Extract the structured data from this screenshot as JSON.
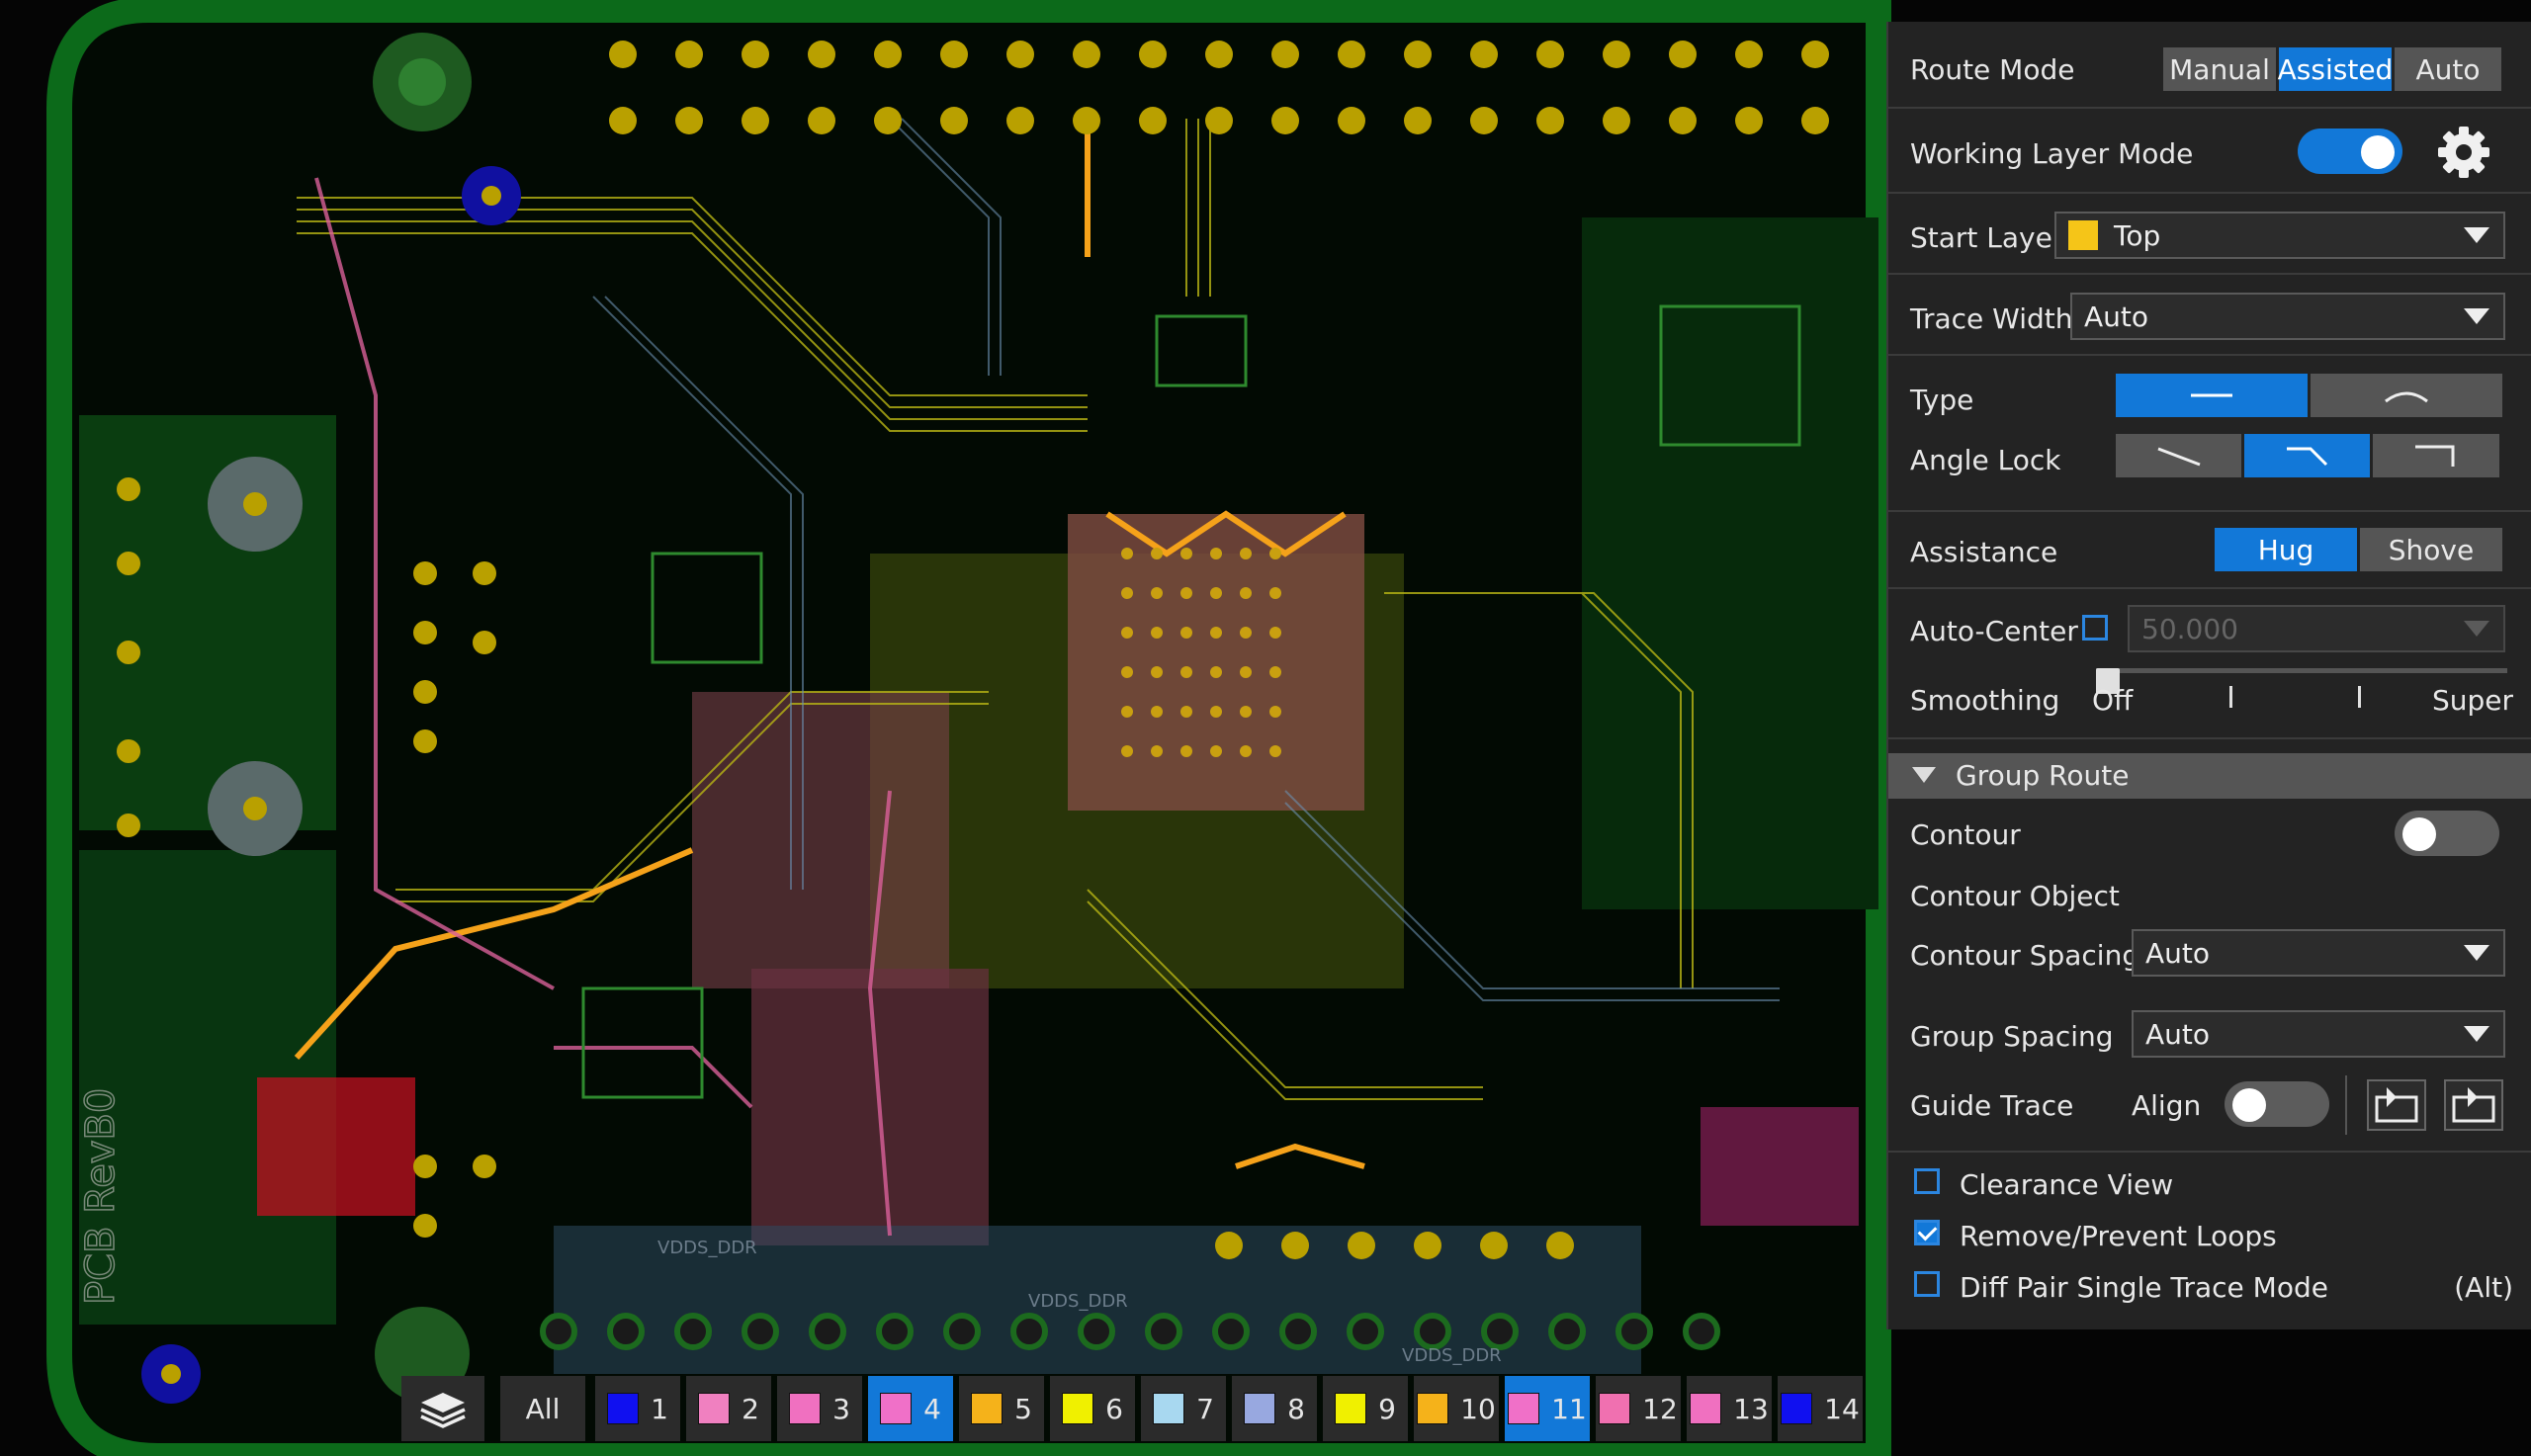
{
  "colors": {
    "accent": "#1278d8",
    "panel_bg": "#232323",
    "board_green": "#0b4d14",
    "trace_yellow": "#b9b615",
    "trace_orange": "#f5a21a",
    "trace_pink": "#d9609a",
    "trace_blue": "#3a55d0"
  },
  "panel": {
    "route_mode": {
      "label": "Route Mode",
      "options": [
        "Manual",
        "Assisted",
        "Auto"
      ],
      "selected": "Assisted"
    },
    "working_layer_mode": {
      "label": "Working Layer Mode",
      "on": true,
      "icon": "gear-icon"
    },
    "start_layer": {
      "label": "Start Layer",
      "value": "Top",
      "swatch": "#f5c518"
    },
    "trace_width": {
      "label": "Trace Width",
      "value": "Auto"
    },
    "type": {
      "label": "Type",
      "options": [
        "straight-line-icon",
        "arc-icon"
      ],
      "selected": "straight-line-icon"
    },
    "angle_lock": {
      "label": "Angle Lock",
      "options": [
        "any-angle-icon",
        "angle-45-icon",
        "angle-90-icon"
      ],
      "selected": "angle-45-icon"
    },
    "assistance": {
      "label": "Assistance",
      "options": [
        "Hug",
        "Shove"
      ],
      "selected": "Hug"
    },
    "auto_center": {
      "label": "Auto-Center",
      "checked": false,
      "value": "50.000"
    },
    "smoothing": {
      "label": "Smoothing",
      "min_label": "Off",
      "max_label": "Super",
      "level": 0
    },
    "group_route": {
      "header": "Group Route",
      "contour": {
        "label": "Contour",
        "on": false
      },
      "contour_object": {
        "label": "Contour Object"
      },
      "contour_spacing": {
        "label": "Contour Spacing",
        "value": "Auto"
      },
      "group_spacing": {
        "label": "Group Spacing",
        "value": "Auto"
      },
      "guide_trace": {
        "label": "Guide Trace",
        "align_label": "Align",
        "align_on": false
      }
    },
    "checkboxes": [
      {
        "label": "Clearance View",
        "checked": false,
        "hint": ""
      },
      {
        "label": "Remove/Prevent Loops",
        "checked": true,
        "hint": ""
      },
      {
        "label": "Diff Pair Single Trace Mode",
        "checked": false,
        "hint": "(Alt)"
      }
    ]
  },
  "layer_bar": {
    "all_label": "All",
    "layers": [
      {
        "num": "1",
        "color": "#1010f0",
        "active": false
      },
      {
        "num": "2",
        "color": "#f080c0",
        "active": false
      },
      {
        "num": "3",
        "color": "#f070c0",
        "active": false
      },
      {
        "num": "4",
        "color": "#f070c8",
        "active": true
      },
      {
        "num": "5",
        "color": "#f5b21a",
        "active": false
      },
      {
        "num": "6",
        "color": "#f0f000",
        "active": false
      },
      {
        "num": "7",
        "color": "#a8d8f0",
        "active": false
      },
      {
        "num": "8",
        "color": "#98a8e0",
        "active": false
      },
      {
        "num": "9",
        "color": "#f0f000",
        "active": false
      },
      {
        "num": "10",
        "color": "#f5b21a",
        "active": false
      },
      {
        "num": "11",
        "color": "#f070c8",
        "active": true
      },
      {
        "num": "12",
        "color": "#f070b0",
        "active": false
      },
      {
        "num": "13",
        "color": "#f070c0",
        "active": false
      },
      {
        "num": "14",
        "color": "#1010f0",
        "active": false
      }
    ]
  },
  "board": {
    "silkscreen_text": "PCB RevB0",
    "net_labels": [
      "VDDS_DDR",
      "VDDS_DDR",
      "VDDS_DDR"
    ]
  }
}
